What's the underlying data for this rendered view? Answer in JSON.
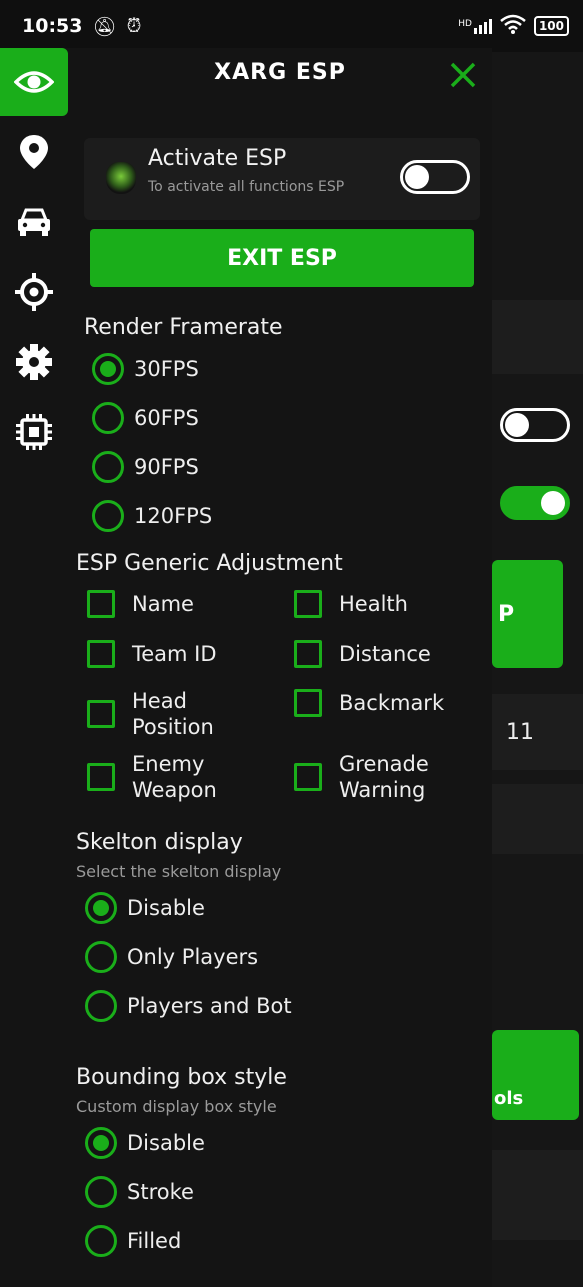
{
  "status_bar": {
    "time": "10:53",
    "signal_label": "HD",
    "battery": "100"
  },
  "panel": {
    "title": "XARG ESP",
    "activate": {
      "heading": "Activate ESP",
      "subtitle": "To activate all functions ESP",
      "toggle_on": false
    },
    "exit_button": "EXIT ESP",
    "render_framerate": {
      "title": "Render Framerate",
      "options": [
        "30FPS",
        "60FPS",
        "90FPS",
        "120FPS"
      ],
      "selected": "30FPS"
    },
    "generic_adjustment": {
      "title": "ESP Generic Adjustment",
      "left": [
        "Name",
        "Team ID",
        "Head\nPosition",
        "Enemy\nWeapon"
      ],
      "right": [
        "Health",
        "Distance",
        "Backmark",
        "Grenade\nWarning"
      ]
    },
    "skeleton": {
      "title": "Skelton display",
      "subtitle": "Select the skelton display",
      "options": [
        "Disable",
        "Only Players",
        "Players and Bot"
      ],
      "selected": "Disable"
    },
    "bounding_box": {
      "title": "Bounding box style",
      "subtitle": "Custom display box style",
      "options": [
        "Disable",
        "Stroke",
        "Filled"
      ],
      "selected": "Disable"
    }
  },
  "background_app": {
    "button_fragment": "P",
    "number_fragment": "11",
    "tools_fragment": "ols"
  },
  "colors": {
    "accent": "#1aae1a",
    "panel_bg": "#141414",
    "card_bg": "#1c1c1c"
  },
  "rail_icons": [
    "eye-icon",
    "location-pin-icon",
    "car-icon",
    "crosshair-icon",
    "gear-icon",
    "chip-icon"
  ]
}
